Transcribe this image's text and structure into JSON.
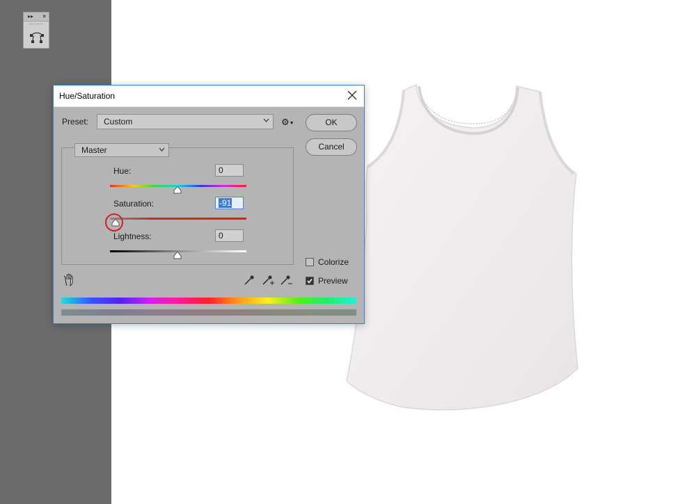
{
  "dialog": {
    "title": "Hue/Saturation",
    "preset_label": "Preset:",
    "preset_value": "Custom",
    "ok_label": "OK",
    "cancel_label": "Cancel",
    "channel_value": "Master"
  },
  "adjustments": {
    "hue": {
      "label": "Hue:",
      "value": "0"
    },
    "saturation": {
      "label": "Saturation:",
      "value": "-91"
    },
    "lightness": {
      "label": "Lightness:",
      "value": "0"
    }
  },
  "options": {
    "colorize_label": "Colorize",
    "colorize_checked": false,
    "preview_label": "Preview",
    "preview_checked": true
  },
  "icons": [
    "collapse-icon",
    "close-icon",
    "path-tool-icon",
    "chevron-down-icon",
    "gear-icon",
    "hand-tool-icon",
    "eyedropper-icon",
    "eyedropper-plus-icon",
    "eyedropper-minus-icon",
    "checkmark-icon"
  ],
  "colors": {
    "dialog_bg": "#b4b4b4",
    "left_panel": "#6b6b6b",
    "accent_border": "#3f7fc0",
    "highlight_ring": "#d02020"
  }
}
